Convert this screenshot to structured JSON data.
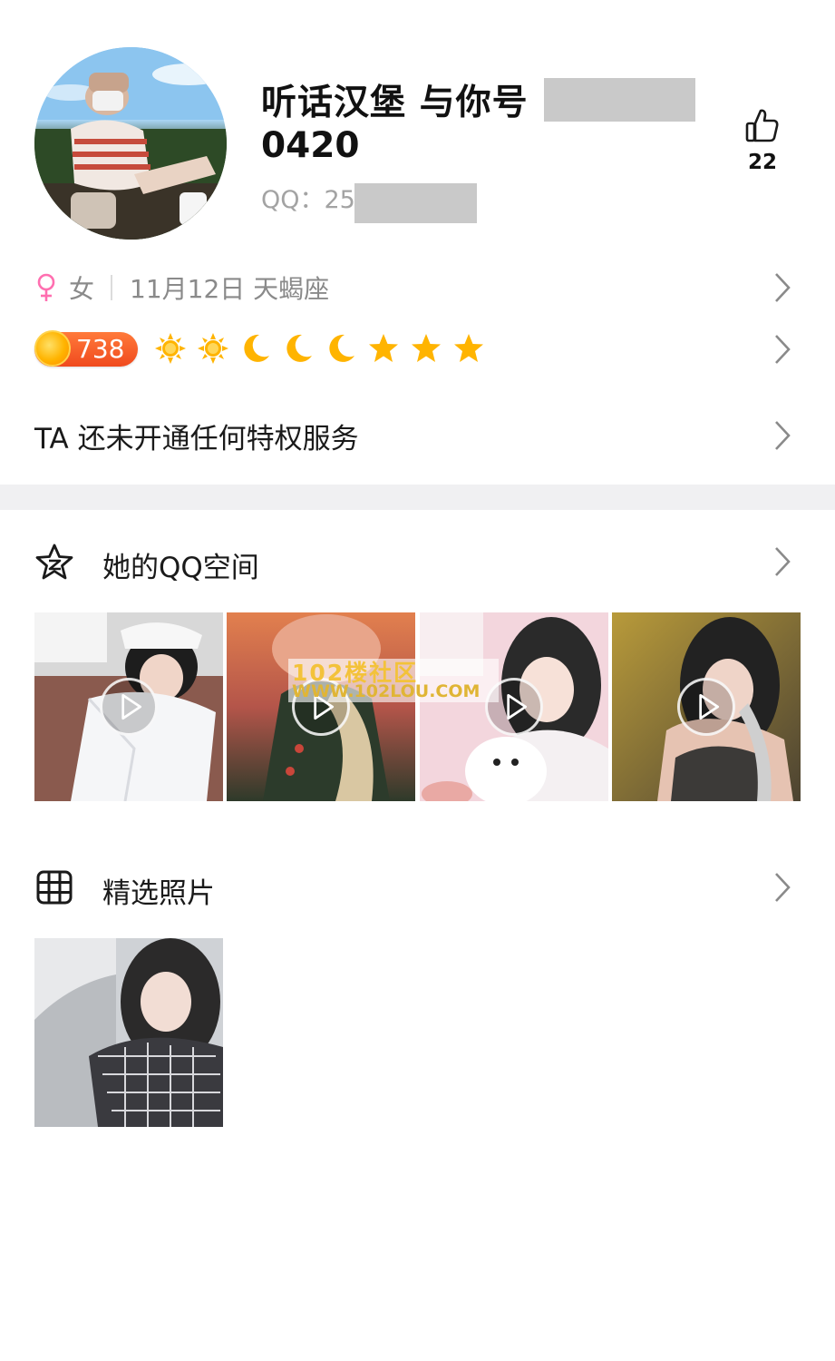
{
  "profile": {
    "name_line1": "听话汉堡  与你号",
    "name_line2": "0420",
    "qq_label": "QQ：25",
    "likes": "22"
  },
  "info": {
    "gender": "女",
    "birthday": "11月12日 天蝎座"
  },
  "level": {
    "value": "738",
    "icons": [
      "sun-icon",
      "sun-icon",
      "moon-icon",
      "moon-icon",
      "moon-icon",
      "star-icon",
      "star-icon",
      "star-icon"
    ]
  },
  "privilege_text": "TA 还未开通任何特权服务",
  "qzone": {
    "title": "她的QQ空间",
    "items": [
      "video-thumbnail",
      "video-thumbnail",
      "video-thumbnail",
      "video-thumbnail"
    ]
  },
  "photos": {
    "title": "精选照片"
  },
  "watermark": {
    "line1": "102楼社区",
    "line2": "WWW.102LOU.COM"
  },
  "colors": {
    "accent_level": "#f04a1e",
    "gender_female": "#ff6fb0",
    "level_icon_gold": "#ffb400",
    "divider": "#f0f0f2"
  }
}
